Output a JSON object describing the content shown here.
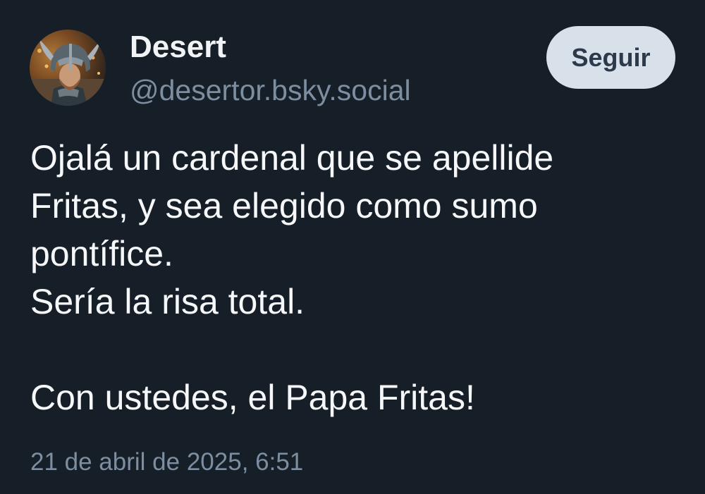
{
  "post": {
    "author": {
      "display_name": "Desert",
      "handle": "@desertor.bsky.social",
      "avatar_icon": "helmeted-warrior-avatar"
    },
    "follow_label": "Seguir",
    "text_lines": [
      "Ojalá un cardenal que se apellide",
      "Fritas, y sea elegido como sumo",
      "pontífice.",
      "Sería la risa total.",
      "",
      "Con ustedes, el Papa Fritas!"
    ],
    "timestamp": "21 de abril de 2025, 6:51"
  },
  "colors": {
    "background": "#161e27",
    "text": "#f5f7f9",
    "muted": "#7d8ea0",
    "button_bg": "#d8e0ea",
    "button_text": "#2c3a4b"
  }
}
